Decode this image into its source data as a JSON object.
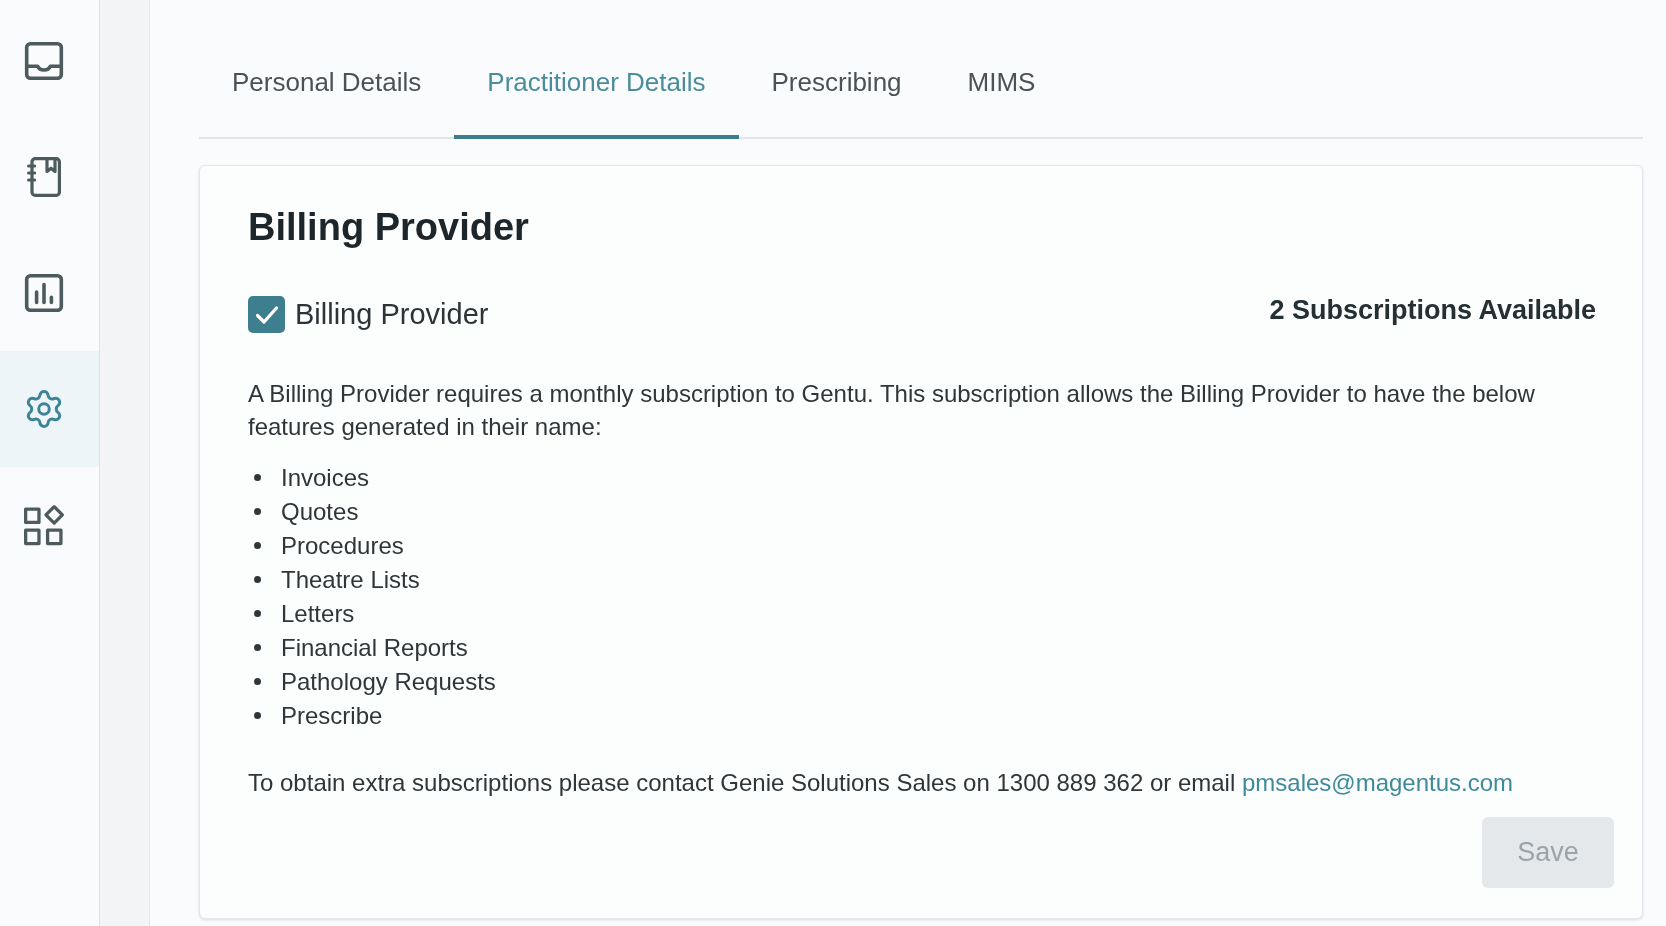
{
  "sidebar": {
    "items": [
      {
        "selected": false
      },
      {
        "selected": false
      },
      {
        "selected": false
      },
      {
        "selected": true
      },
      {
        "selected": false
      }
    ]
  },
  "tabs": [
    {
      "label": "Personal Details",
      "selected": false
    },
    {
      "label": "Practitioner Details",
      "selected": true
    },
    {
      "label": "Prescribing",
      "selected": false
    },
    {
      "label": "MIMS",
      "selected": false
    }
  ],
  "card": {
    "title": "Billing Provider",
    "checkbox": {
      "label": "Billing Provider",
      "checked": true
    },
    "subscriptions": "2 Subscriptions Available",
    "description": "A Billing Provider requires a monthly subscription to Gentu. This subscription allows the Billing Provider to have the below features generated in their name:",
    "features": [
      "Invoices",
      "Quotes",
      "Procedures",
      "Theatre Lists",
      "Letters",
      "Financial Reports",
      "Pathology Requests",
      "Prescribe"
    ],
    "contact": {
      "text": "To obtain extra subscriptions please contact Genie Solutions Sales on 1300 889 362 or email",
      "link": "pmsales@magentus.com"
    },
    "save_button": {
      "label": "Save",
      "disabled": true
    }
  }
}
